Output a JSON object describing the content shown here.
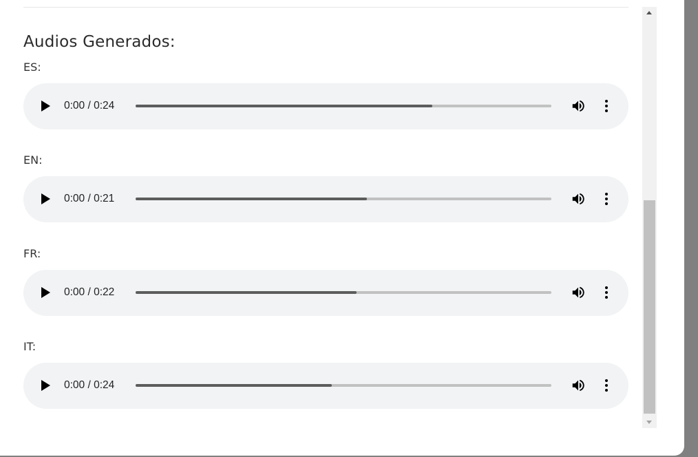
{
  "section": {
    "title": "Audios Generados:"
  },
  "audios": [
    {
      "label": "ES:",
      "time": "0:00 / 0:24",
      "buffered": 0.713
    },
    {
      "label": "EN:",
      "time": "0:00 / 0:21",
      "buffered": 0.557
    },
    {
      "label": "FR:",
      "time": "0:00 / 0:22",
      "buffered": 0.531
    },
    {
      "label": "IT:",
      "time": "0:00 / 0:24",
      "buffered": 0.472
    }
  ],
  "icons": {
    "play": "play-icon",
    "volume": "volume-icon",
    "more": "more-options-icon"
  },
  "colors": {
    "player_background": "#f1f3f4",
    "progress_played": "#5c5c5c",
    "progress_remaining": "#c1c1c1",
    "backdrop": "#808080"
  }
}
